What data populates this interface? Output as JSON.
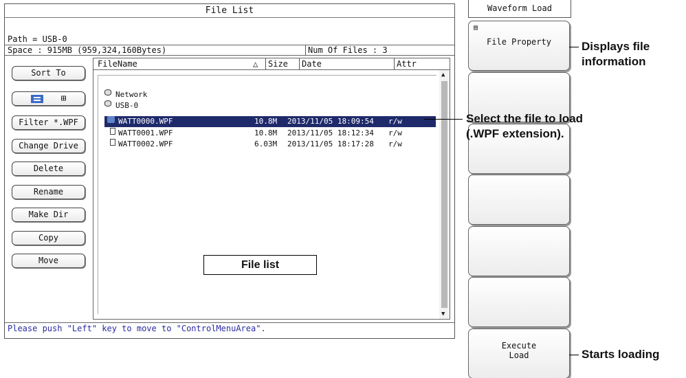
{
  "window": {
    "title": "File List",
    "path_text": "Path = USB-0",
    "space_text": "Space : 915MB (959,324,160Bytes)",
    "num_files_text": "Num Of Files : 3",
    "status_text": "Please push \"Left\" key to move to \"ControlMenuArea\"."
  },
  "side_buttons": {
    "sort_to": "Sort To",
    "filter": "Filter *.WPF",
    "change_drive": "Change Drive",
    "delete": "Delete",
    "rename": "Rename",
    "make_dir": "Make Dir",
    "copy": "Copy",
    "move": "Move",
    "view_grid_glyph": "⊞"
  },
  "table": {
    "columns": {
      "name": "FileName",
      "sort_glyph": "△",
      "size": "Size",
      "date": "Date",
      "attr": "Attr"
    },
    "tree": [
      "Network",
      "USB-0"
    ],
    "files": [
      {
        "name": "WATT0000.WPF",
        "size": "10.8M",
        "date": "2013/11/05 18:09:54",
        "attr": "r/w",
        "selected": true
      },
      {
        "name": "WATT0001.WPF",
        "size": "10.8M",
        "date": "2013/11/05 18:12:34",
        "attr": "r/w",
        "selected": false
      },
      {
        "name": "WATT0002.WPF",
        "size": "6.03M",
        "date": "2013/11/05 18:17:28",
        "attr": "r/w",
        "selected": false
      }
    ]
  },
  "callout": {
    "file_list": "File list"
  },
  "menu": {
    "title": "Waveform Load",
    "file_property": "File Property",
    "execute_line1": "Execute",
    "execute_line2": "Load"
  },
  "annotations": {
    "file_info_line1": "Displays file",
    "file_info_line2": "information",
    "select_line1": "Select the file to load",
    "select_line2": "(.WPF extension).",
    "start": "Starts loading"
  },
  "colors": {
    "selected_row_bg": "#1f2a6b",
    "status_text": "#2a2aa0",
    "accent_icon": "#3a6cc6"
  }
}
